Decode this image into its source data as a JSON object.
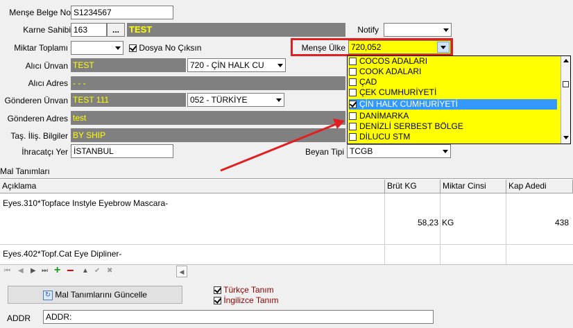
{
  "form": {
    "mense_belge_no": {
      "label": "Menşe Belge No",
      "value": "S1234567"
    },
    "karne_sahibi": {
      "label": "Karne Sahibi",
      "code": "163",
      "ellipsis": "...",
      "name": "TEST"
    },
    "notify": {
      "label": "Notify",
      "value": ""
    },
    "miktar_toplami": {
      "label": "Miktar Toplamı",
      "value": ""
    },
    "dosya_no": {
      "label": "Dosya No Çıksın",
      "checked": true
    },
    "mense_ulke": {
      "label": "Menşe Ülke",
      "value": "720,052"
    },
    "alici_unvan": {
      "label": "Alıcı Ünvan",
      "value": "TEST",
      "country": "720 - ÇİN HALK CU"
    },
    "alici_adres": {
      "label": "Alıcı Adres",
      "value": "- - -"
    },
    "gonderen_unvan": {
      "label": "Gönderen Ünvan",
      "value": "TEST 111",
      "country": "052 - TÜRKİYE"
    },
    "gonderen_adres": {
      "label": "Gönderen Adres",
      "value": "test"
    },
    "tas_ilis": {
      "label": "Taş. İliş. Bilgiler",
      "value": "BY SHIP"
    },
    "ihracatci_yer": {
      "label": "İhracatçı Yer",
      "value": "İSTANBUL"
    },
    "beyan_tipi": {
      "label": "Beyan Tipi",
      "value": "TCGB"
    }
  },
  "country_list": [
    {
      "label": "COCOS ADALARI",
      "checked": false
    },
    {
      "label": "COOK ADALARI",
      "checked": false
    },
    {
      "label": "ÇAD",
      "checked": false
    },
    {
      "label": "ÇEK CUMHURİYETİ",
      "checked": false
    },
    {
      "label": "ÇİN HALK CUMHURİYETİ",
      "checked": true,
      "selected": true
    },
    {
      "label": "DANİMARKA",
      "checked": false
    },
    {
      "label": "DENİZLİ SERBEST BÖLGE",
      "checked": false
    },
    {
      "label": "DİLUCU STM",
      "checked": false
    }
  ],
  "goods": {
    "section_title": "Mal Tanımları",
    "columns": [
      "Açıklama",
      "Brüt KG",
      "Miktar Cinsi",
      "Kap Adedi"
    ],
    "rows": [
      {
        "aciklama": "Eyes.310*Topface Instyle Eyebrow Mascara-",
        "brut": "58,23",
        "cinsi": "KG",
        "kap": "438"
      },
      {
        "aciklama": "Eyes.402*Topf.Cat Eye Dipliner-",
        "brut": "",
        "cinsi": "",
        "kap": ""
      }
    ]
  },
  "footer": {
    "update_button": "Mal Tanımlarını Güncelle",
    "turkce_tanim": {
      "label": "Türkçe Tanım",
      "checked": true
    },
    "ingilizce_tanim": {
      "label": "İngilizce Tanım",
      "checked": true
    },
    "addr_label": "ADDR",
    "addr_value": "ADDR:"
  },
  "colors": {
    "highlight_yellow": "#ffff00",
    "gray_field": "#808080",
    "red_accent": "#e02020",
    "selection_blue": "#3399ff",
    "label_red": "#8b0000"
  }
}
